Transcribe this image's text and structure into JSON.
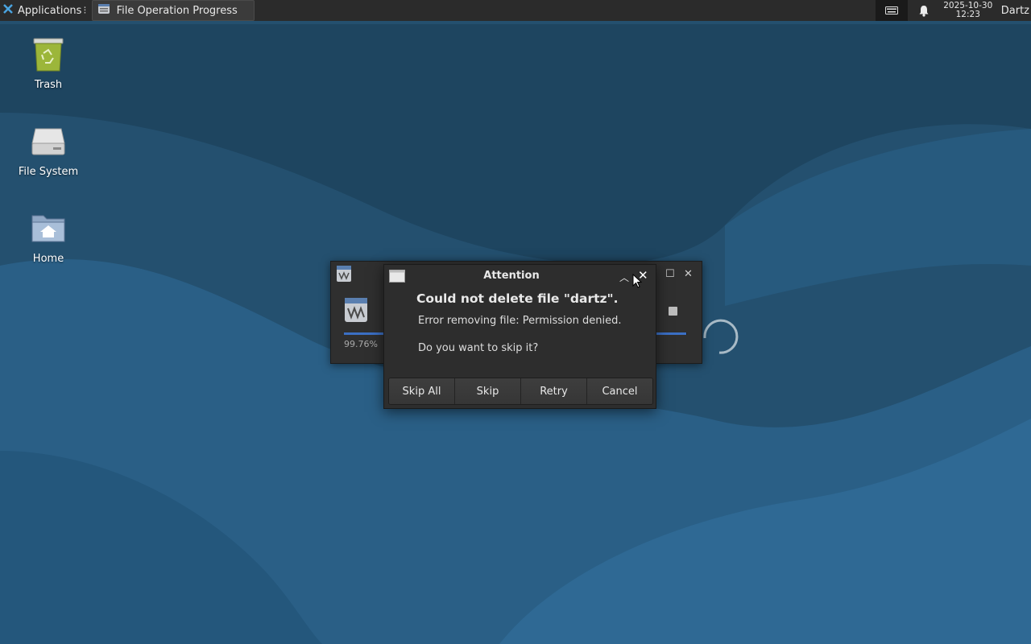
{
  "panel": {
    "applications_label": "Applications",
    "applications_sep": "⁝",
    "task_label": "File Operation Progress",
    "clock_date": "2025-10-30",
    "clock_time": "12:23",
    "user": "Dartz"
  },
  "desktop_icons": [
    {
      "label": "Trash",
      "icon": "trash-icon"
    },
    {
      "label": "File System",
      "icon": "drive-icon"
    },
    {
      "label": "Home",
      "icon": "home-folder-icon"
    }
  ],
  "progress_window": {
    "percent_label": "99.76%",
    "progress": 0.9976
  },
  "dialog": {
    "title": "Attention",
    "heading": "Could not delete file \"dartz\".",
    "detail": "Error removing file: Permission denied.",
    "question": "Do you want to skip it?",
    "buttons": {
      "skip_all": "Skip All",
      "skip": "Skip",
      "retry": "Retry",
      "cancel": "Cancel"
    }
  },
  "colors": {
    "desktop": "#24506f",
    "panel": "#2b2b2b",
    "progress_fill": "#3b6fc4"
  }
}
